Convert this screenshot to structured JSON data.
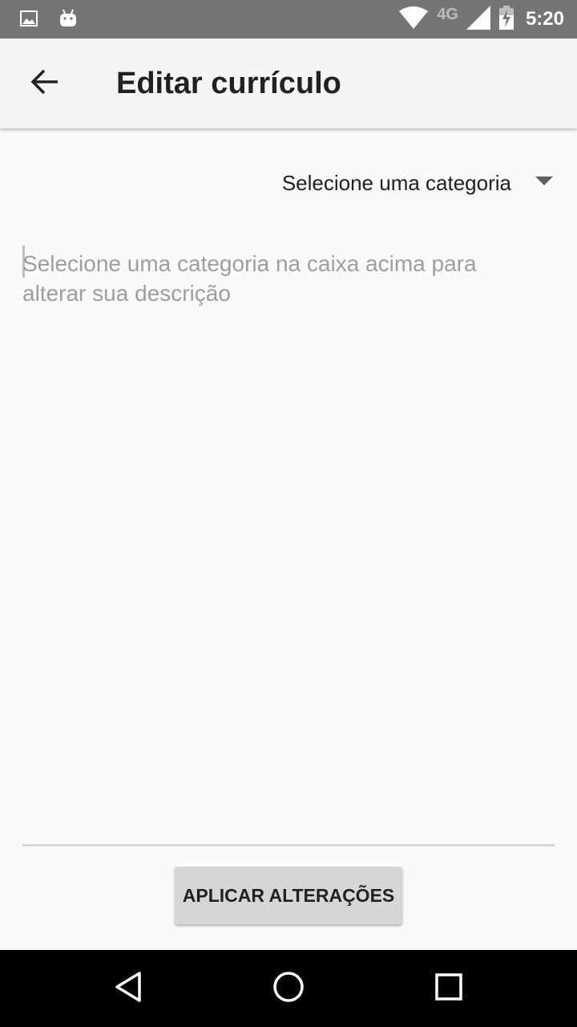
{
  "status_bar": {
    "network": "4G",
    "time": "5:20"
  },
  "app_bar": {
    "title": "Editar currículo"
  },
  "category_spinner": {
    "selected": "Selecione uma categoria"
  },
  "description": {
    "placeholder": "Selecione uma categoria na caixa acima para alterar sua descrição",
    "value": ""
  },
  "apply_button": {
    "label": "APLICAR ALTERAÇÕES"
  },
  "colors": {
    "status_bar": "#757575",
    "app_bar": "#f5f5f5",
    "background": "#fafafa",
    "button": "#d6d6d6",
    "nav_bar": "#000000"
  }
}
